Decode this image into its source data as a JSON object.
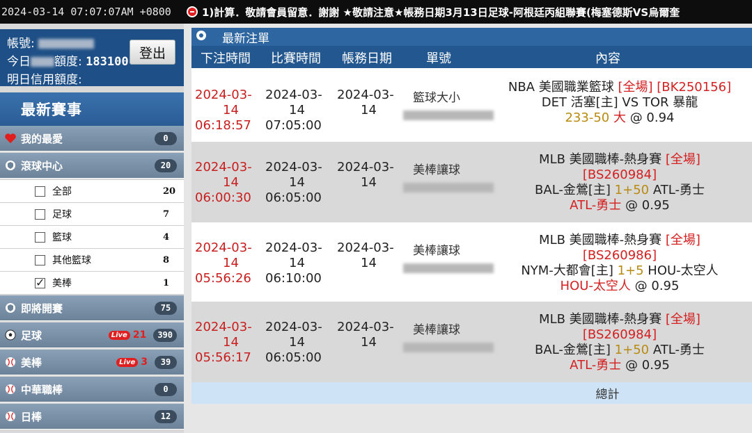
{
  "topbar": {
    "clock": "2024-03-14 07:07:07AM +0800",
    "ticker": "1)計算．敬請會員留意．謝謝 ★敬請注意★帳務日期3月13日足球-阿根廷丙組聯賽(梅塞德斯VS烏爾奎"
  },
  "account": {
    "name_label": "帳號:",
    "credit_label_a": "今日",
    "credit_label_b": "額度:",
    "credit_value": "183100",
    "next_label": "明日信用額度:",
    "logout_label": "登出"
  },
  "sidebar": {
    "latest_events": "最新賽事",
    "favorites": {
      "label": "我的最愛",
      "count": "0"
    },
    "live_center": {
      "label": "滾球中心",
      "count": "20"
    },
    "live_subs": [
      {
        "label": "全部",
        "count": "20",
        "checked": false
      },
      {
        "label": "足球",
        "count": "7",
        "checked": false
      },
      {
        "label": "籃球",
        "count": "4",
        "checked": false
      },
      {
        "label": "其他籃球",
        "count": "8",
        "checked": false
      },
      {
        "label": "美棒",
        "count": "1",
        "checked": true
      }
    ],
    "upcoming": {
      "label": "即將開賽",
      "count": "75"
    },
    "sports": [
      {
        "label": "足球",
        "live_badge": "Live",
        "live_count": "21",
        "count": "390"
      },
      {
        "label": "美棒",
        "live_badge": "Live",
        "live_count": "3",
        "count": "39"
      },
      {
        "label": "中華職棒",
        "count": "0"
      },
      {
        "label": "日棒",
        "count": "12"
      }
    ]
  },
  "main": {
    "panel_title": "最新注單",
    "headers": [
      "下注時間",
      "比賽時間",
      "帳務日期",
      "單號",
      "內容"
    ],
    "total_label": "總計",
    "rows": [
      {
        "bet_date_a": "2024-03-",
        "bet_date_b": "14",
        "bet_time": "06:18:57",
        "match_date_a": "2024-03-",
        "match_date_b": "14",
        "match_time": "07:05:00",
        "acct_date_a": "2024-03-",
        "acct_date_b": "14",
        "type": "籃球大小",
        "line1": "NBA 美國職業籃球 ",
        "line1_red": "[全場] [BK250156]",
        "line2": "DET 活塞[主] VS TOR 暴龍",
        "line3_gold": "233-50",
        "line3_red": " 大",
        "line3_odds": " @ 0.94"
      },
      {
        "bet_date_a": "2024-03-",
        "bet_date_b": "14",
        "bet_time": "06:00:30",
        "match_date_a": "2024-03-",
        "match_date_b": "14",
        "match_time": "06:05:00",
        "acct_date_a": "2024-03-",
        "acct_date_b": "14",
        "type": "美棒讓球",
        "line1": "MLB 美國職棒-熱身賽 ",
        "line1_red": "[全場]",
        "line1b_red": "[BS260984]",
        "line2a": "BAL-金鶯[主] ",
        "line2_gold": "1+50",
        "line2b": " ATL-勇士",
        "line3_red": "ATL-勇士",
        "line3_odds": " @ 0.95"
      },
      {
        "bet_date_a": "2024-03-",
        "bet_date_b": "14",
        "bet_time": "05:56:26",
        "match_date_a": "2024-03-",
        "match_date_b": "14",
        "match_time": "06:10:00",
        "acct_date_a": "2024-03-",
        "acct_date_b": "14",
        "type": "美棒讓球",
        "line1": "MLB 美國職棒-熱身賽 ",
        "line1_red": "[全場]",
        "line1b_red": "[BS260986]",
        "line2a": "NYM-大都會[主] ",
        "line2_gold": "1+5",
        "line2b": " HOU-太空人",
        "line3_red": "HOU-太空人",
        "line3_odds": " @ 0.95"
      },
      {
        "bet_date_a": "2024-03-",
        "bet_date_b": "14",
        "bet_time": "05:56:17",
        "match_date_a": "2024-03-",
        "match_date_b": "14",
        "match_time": "06:05:00",
        "acct_date_a": "2024-03-",
        "acct_date_b": "14",
        "type": "美棒讓球",
        "line1": "MLB 美國職棒-熱身賽 ",
        "line1_red": "[全場]",
        "line1b_red": "[BS260984]",
        "line2a": "BAL-金鶯[主] ",
        "line2_gold": "1+50",
        "line2b": " ATL-勇士",
        "line3_red": "ATL-勇士",
        "line3_odds": " @ 0.95"
      }
    ]
  },
  "colors": {
    "header_blue": "#23578f",
    "accent_red": "#d42020",
    "gold": "#b88a10",
    "sidebar_gray": "#7b91a7"
  },
  "icons": [
    "heart-icon",
    "shield-icon",
    "soccer-ball-icon",
    "baseball-icon",
    "globe-icon"
  ]
}
